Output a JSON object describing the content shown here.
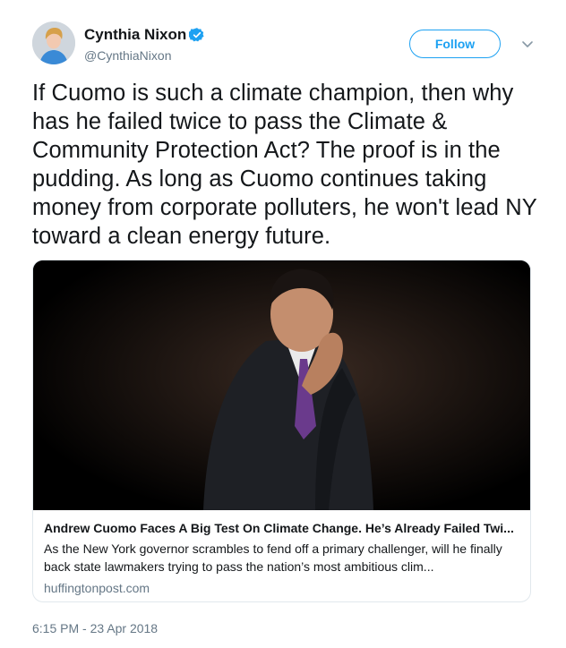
{
  "author": {
    "display_name": "Cynthia Nixon",
    "handle": "@CynthiaNixon",
    "verified": true,
    "avatar_icon": "profile-photo"
  },
  "actions": {
    "follow_label": "Follow",
    "menu_icon": "chevron-down-icon"
  },
  "tweet": {
    "text": "If Cuomo is such a climate champion, then why has he failed twice to pass the Climate & Community Protection Act? The proof is in the pudding. As long as Cuomo continues taking money from corporate polluters, he won't lead NY toward a clean energy future.",
    "timestamp": "6:15 PM - 23 Apr 2018"
  },
  "card": {
    "image_icon": "photo-thinking-man",
    "title": "Andrew Cuomo Faces A Big Test On Climate Change. He’s Already Failed Twi...",
    "description": "As the New York governor scrambles to fend off a primary challenger, will he finally back state lawmakers trying to pass the nation’s most ambitious clim...",
    "domain": "huffingtonpost.com"
  },
  "colors": {
    "accent": "#1da1f2",
    "text": "#14171a",
    "secondary": "#657786",
    "border": "#e1e8ed"
  }
}
